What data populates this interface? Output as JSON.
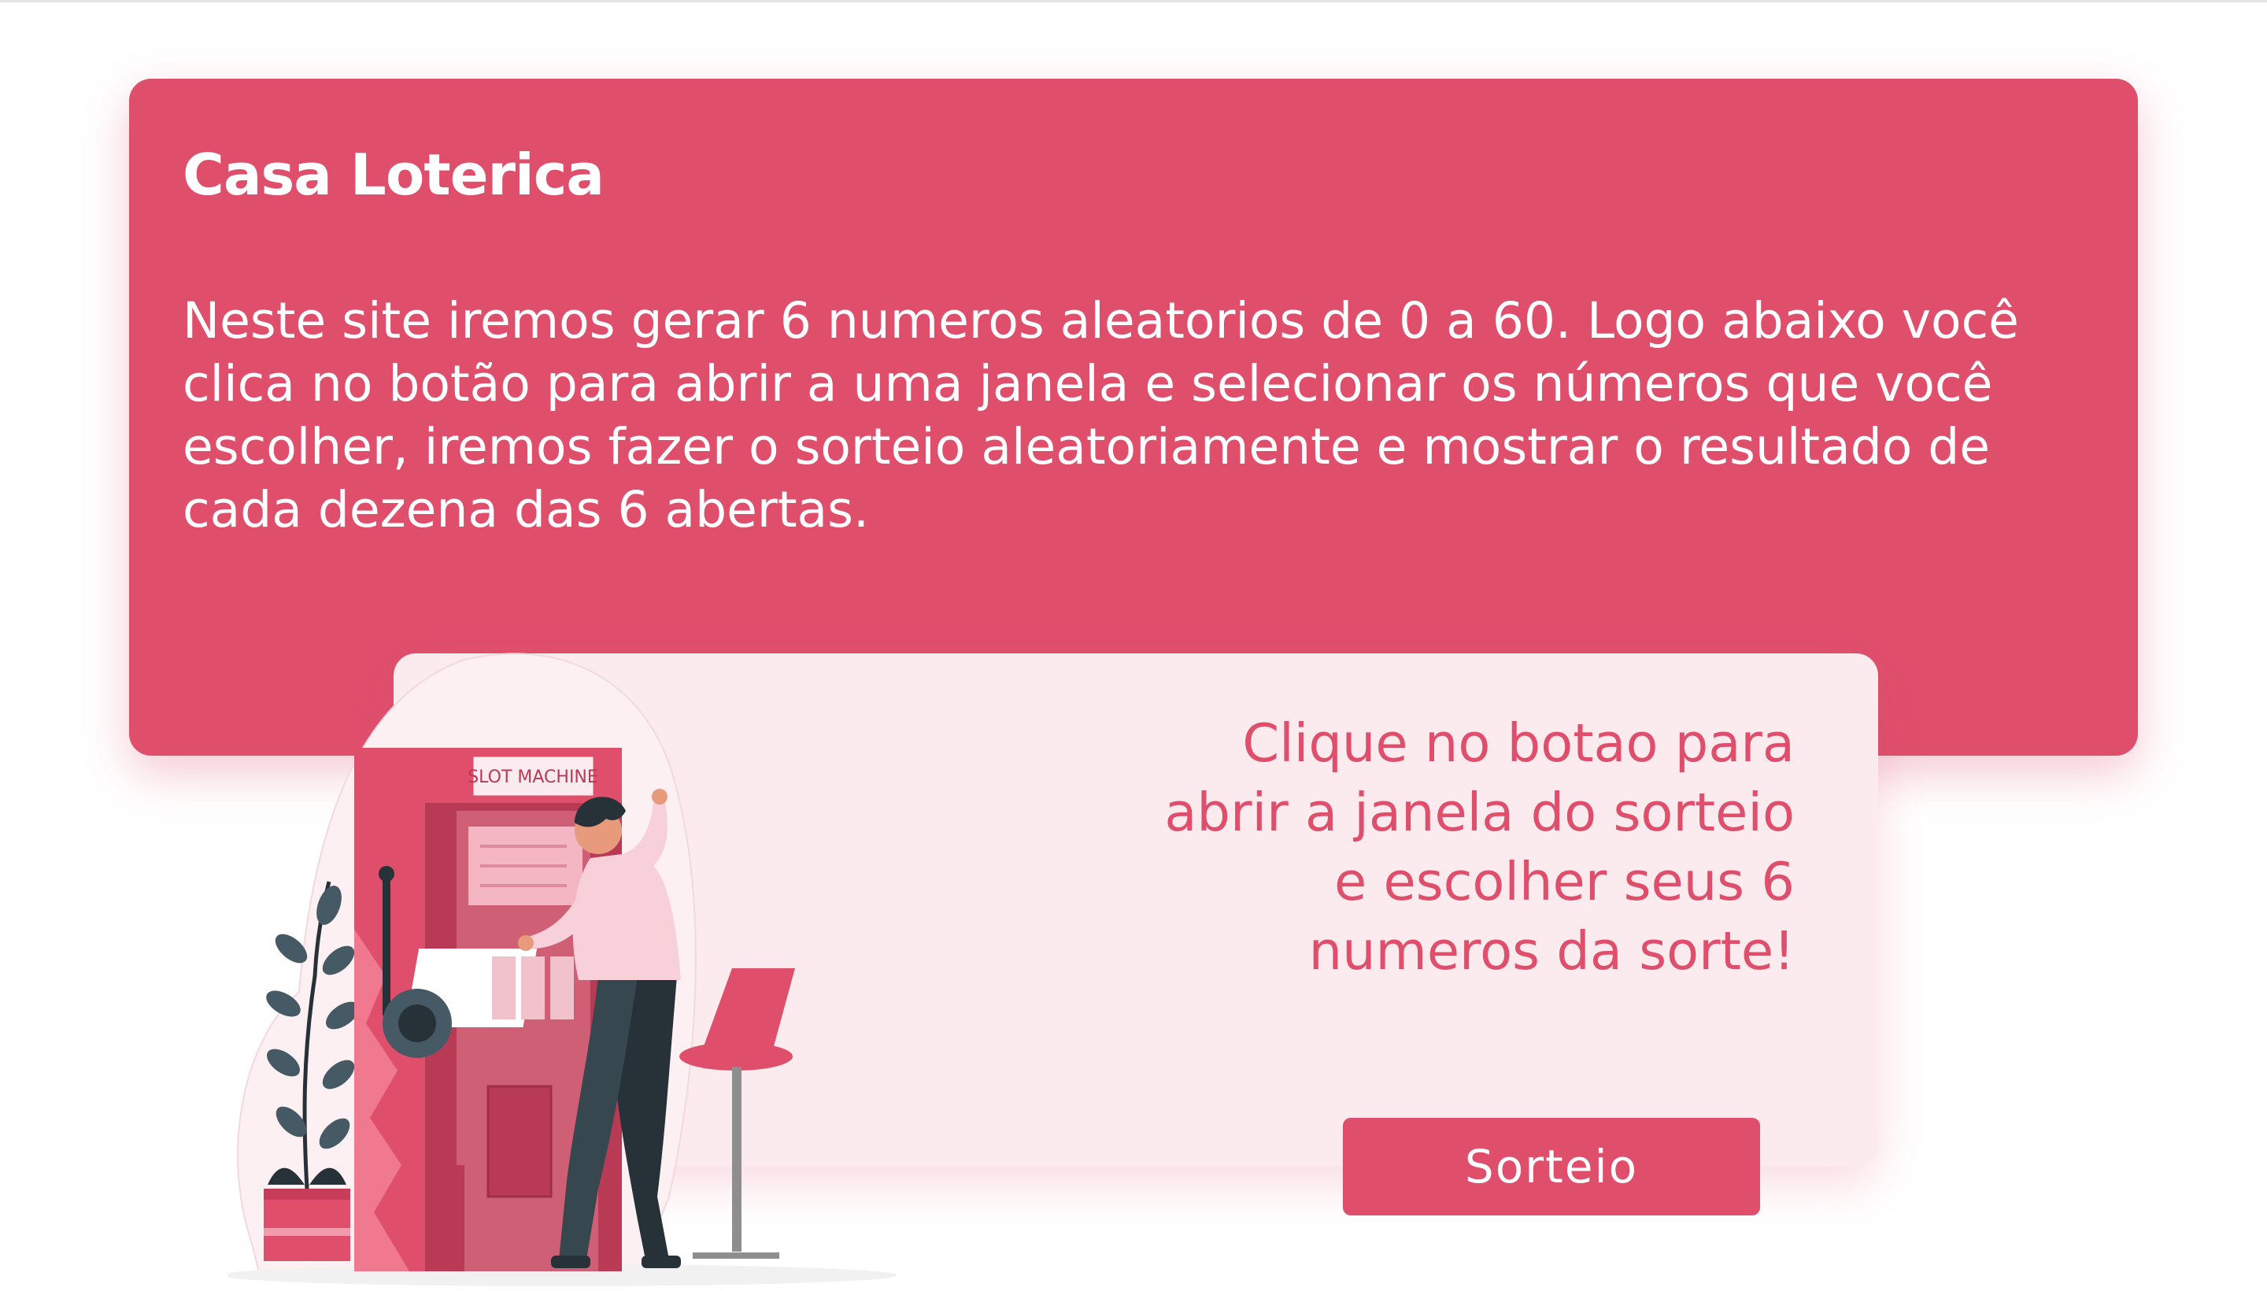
{
  "hero": {
    "title": "Casa Loterica",
    "description": "Neste site iremos gerar 6 numeros aleatorios de 0 a 60. Logo abaixo você clica no botão para abrir a uma janela e selecionar os números que você escolher, iremos fazer o sorteio aleatoriamente e mostrar o resultado de cada dezena das 6 abertas."
  },
  "panel": {
    "text": "Clique no botao para abrir a janela do sorteio e escolher seus 6 numeros da sorte!",
    "button_label": "Sorteio"
  },
  "illustration": {
    "sign_text": "SLOT MACHINE"
  },
  "colors": {
    "accent": "#df4f6c",
    "panel_bg": "#fbebef",
    "text_light": "#ffffff",
    "dark": "#263238"
  }
}
